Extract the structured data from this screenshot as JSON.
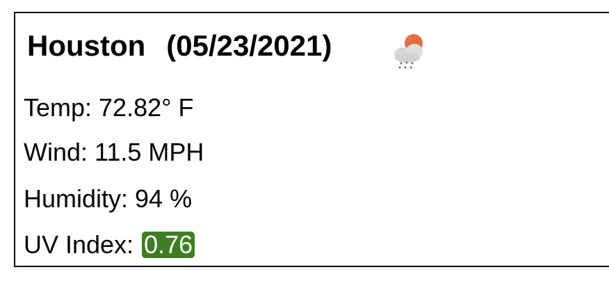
{
  "forecast": {
    "city": "Houston",
    "date": "(05/23/2021)",
    "icon": "light-rain-sun-icon",
    "temp_line": "Temp: 72.82° F",
    "wind_line": "Wind: 11.5 MPH",
    "humidity_line": "Humidity: 94 %",
    "uv_label": "UV Index: ",
    "uv_value": "0.76",
    "uv_color": "#3f7e22"
  }
}
